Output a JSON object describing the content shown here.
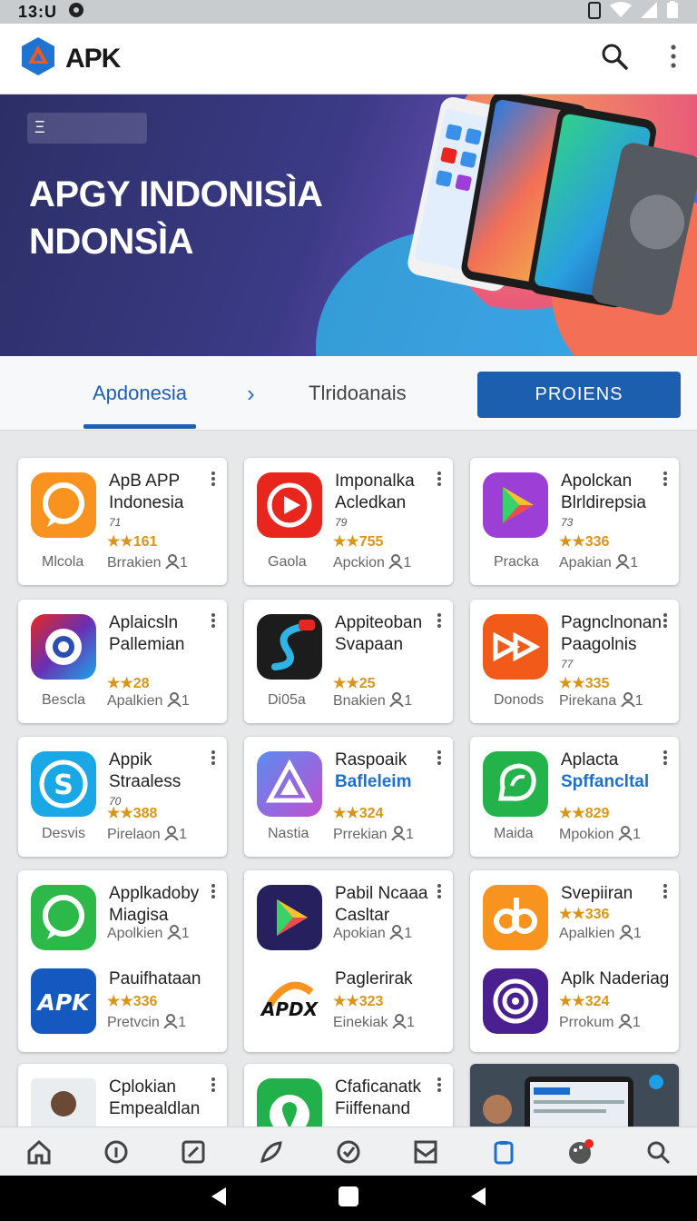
{
  "status": {
    "time": "13:U"
  },
  "appbar": {
    "title": "APK"
  },
  "banner": {
    "pill": "Ξ",
    "title_line1": "APGY INDONISÌA",
    "title_line2": "NDONSÌA"
  },
  "tabs": {
    "tab1": "Apdonesia",
    "chevron": "›",
    "tab2": "Tlridoanais",
    "button": "PROIENS"
  },
  "cards": [
    {
      "name1": "ApB APP",
      "name2": "Indonesia",
      "sub": "71",
      "rating": "★★161",
      "left": "Mlcola",
      "right": "Brrakien",
      "count": "1",
      "icon": "chat-icon",
      "color": "#f7931e"
    },
    {
      "name1": "Imponalka",
      "name2": "Acledkan",
      "sub": "79",
      "rating": "★★755",
      "left": "Gaola",
      "right": "Apckion",
      "count": "1",
      "icon": "video-icon",
      "color": "#e8261e"
    },
    {
      "name1": "Apolckan",
      "name2": "Blrldirepsia",
      "sub": "73",
      "rating": "★★336",
      "left": "Pracka",
      "right": "Apakian",
      "count": "1",
      "icon": "play-icon",
      "color": "#9b3fd6"
    },
    {
      "name1": "Aplaicsln",
      "name2": "Pallemian",
      "sub": "",
      "rating": "★★28",
      "left": "Bescla",
      "right": "Apalkien",
      "count": "1",
      "icon": "camera-icon",
      "color": "#6a2fb4"
    },
    {
      "name1": "Appiteoban",
      "name2": "Svapaan",
      "sub": "",
      "rating": "★★25",
      "left": "Di05a",
      "right": "Bnakien",
      "count": "1",
      "icon": "swirl-icon",
      "color": "#1c1c1c"
    },
    {
      "name1": "Pagnclnonan",
      "name2": "Paagolnis",
      "sub": "77",
      "rating": "★★335",
      "left": "Donods",
      "right": "Pirekana",
      "count": "1",
      "icon": "forward-icon",
      "color": "#f25a1a"
    },
    {
      "name1": "Appik",
      "name2": "Straaless",
      "sub": "70",
      "rating": "★★388",
      "left": "Desvis",
      "right": "Pirelaon",
      "count": "1",
      "icon": "s-icon",
      "color": "#1aa7e6"
    },
    {
      "name1": "Raspoaik",
      "name2": "Bafleleim",
      "sub": "",
      "rating": "★★324",
      "left": "Nastia",
      "right": "Prrekian",
      "count": "1",
      "icon": "triangle-icon",
      "color": "#7b5cf0",
      "blue": true
    },
    {
      "name1": "Aplacta",
      "name2": "Spffancltal",
      "sub": "",
      "rating": "★★829",
      "left": "Maida",
      "right": "Mpokion",
      "count": "1",
      "icon": "leaf-chat-icon",
      "color": "#24b34b",
      "blue": true
    },
    {
      "name1": "Applkadoby",
      "name2": "Miagisa",
      "rating": "",
      "right": "Apolkien",
      "count": "1",
      "icon": "chat-icon",
      "color": "#2db84a",
      "name3": "Pauifhataan",
      "rating2": "★★336",
      "right2": "Pretvcin",
      "count2": "1",
      "icon2": "apk-icon",
      "color2": "#1458c0",
      "label2": "APK"
    },
    {
      "name1": "Pabil Ncaaa",
      "name2": "Casltar",
      "rating": "",
      "right": "Apokian",
      "count": "1",
      "icon": "play-icon",
      "color": "#27205f",
      "name3": "Paglerirak",
      "rating2": "★★323",
      "right2": "Einekiak",
      "count2": "1",
      "icon2": "apdx-icon",
      "color2": "#ffffff",
      "label2": "APDX"
    },
    {
      "name1": "Svepiiran",
      "name2": "",
      "rating": "★★336",
      "right": "Apalkien",
      "count": "1",
      "icon": "db-icon",
      "color": "#f7931e",
      "name3": "Aplk Naderiag",
      "rating2": "★★324",
      "right2": "Prrokum",
      "count2": "1",
      "icon2": "target-icon",
      "color2": "#4a1f8f"
    },
    {
      "name1": "Cplokian",
      "name2": "Empealdlan",
      "icon": "avatar",
      "color": "#cfd8dc"
    },
    {
      "name1": "Cfaficanatk",
      "name2": "Fiiffenand",
      "icon": "location-icon",
      "color": "#22b04a"
    }
  ],
  "nav": [
    "home-icon",
    "info-icon",
    "edit-icon",
    "feather-icon",
    "check-icon",
    "inbox-icon",
    "tablet-icon",
    "palette-icon",
    "search-icon"
  ]
}
